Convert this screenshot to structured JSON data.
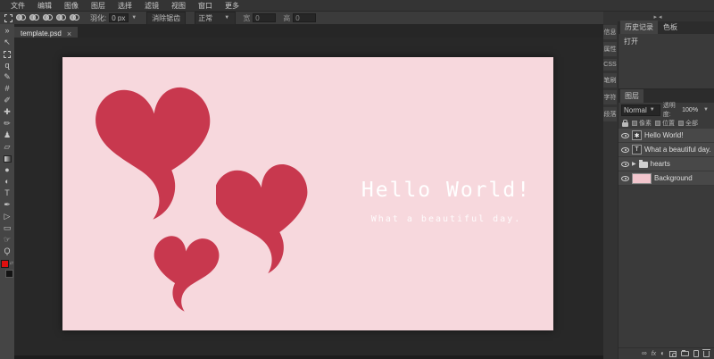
{
  "menu_bar": {
    "items": [
      "文件",
      "编辑",
      "图像",
      "图层",
      "选择",
      "滤镜",
      "视图",
      "窗口",
      "更多"
    ]
  },
  "options_bar": {
    "feather_label": "羽化:",
    "feather_value": "0 px",
    "antialias_label": "消除锯齿",
    "style_value": "正常",
    "width_label": "宽",
    "width_value": "0",
    "height_label": "高",
    "height_value": "0"
  },
  "document_tab": {
    "name": "template.psd",
    "close": "×"
  },
  "icons": {
    "caret_down": "▼",
    "collapse_arrows": "▸◂",
    "double_arrow": "»",
    "expander": "▶"
  },
  "toolbar": {
    "tools": [
      {
        "id": "collapse",
        "glyph": "»"
      },
      {
        "id": "move",
        "glyph": "↖"
      },
      {
        "id": "marquee",
        "glyph": ""
      },
      {
        "id": "lasso",
        "glyph": "ɋ"
      },
      {
        "id": "quick-select",
        "glyph": "✎"
      },
      {
        "id": "crop",
        "glyph": "#"
      },
      {
        "id": "eyedropper",
        "glyph": "✐"
      },
      {
        "id": "healing",
        "glyph": "✚"
      },
      {
        "id": "brush",
        "glyph": "✏"
      },
      {
        "id": "clone-stamp",
        "glyph": "♟"
      },
      {
        "id": "eraser",
        "glyph": "▱"
      },
      {
        "id": "gradient",
        "glyph": ""
      },
      {
        "id": "blur",
        "glyph": "●"
      },
      {
        "id": "dodge",
        "glyph": "◐"
      },
      {
        "id": "type",
        "glyph": "T"
      },
      {
        "id": "pen",
        "glyph": "✒"
      },
      {
        "id": "path-select",
        "glyph": "▷"
      },
      {
        "id": "shape",
        "glyph": "▭"
      },
      {
        "id": "hand",
        "glyph": "☞"
      },
      {
        "id": "zoom",
        "glyph": "Ϙ"
      }
    ],
    "foreground_color": "#dd0f0f",
    "background_color": "#141414"
  },
  "canvas": {
    "background_color": "#f7d8dd",
    "heart_color": "#c8384e",
    "title": "Hello World!",
    "subtitle": "What a beautiful day."
  },
  "right_panel": {
    "side_tabs": [
      "信息",
      "属性",
      "CSS",
      "笔刷",
      "字符",
      "段落"
    ],
    "history": {
      "tabs": [
        "历史记录",
        "色板"
      ],
      "entries": [
        "打开"
      ]
    },
    "layers": {
      "tab": "图层",
      "blend_mode": "Normal",
      "opacity_label": "透明度:",
      "opacity_value": "100%",
      "lock_labels": [
        "像素",
        "位置",
        "全部"
      ],
      "items": [
        {
          "name": "Hello World!",
          "icon": "✱"
        },
        {
          "name": "What a beautiful day.",
          "icon": "T"
        },
        {
          "name": "hearts",
          "icon": "folder"
        },
        {
          "name": "Background",
          "icon": "thumbnail"
        }
      ],
      "footer_icons": [
        "link",
        "effects",
        "adjustment",
        "mask",
        "new-group",
        "new-layer",
        "delete"
      ],
      "footer_glyphs": {
        "link": "∞",
        "effects": "fx",
        "adjustment": "◐"
      }
    }
  }
}
